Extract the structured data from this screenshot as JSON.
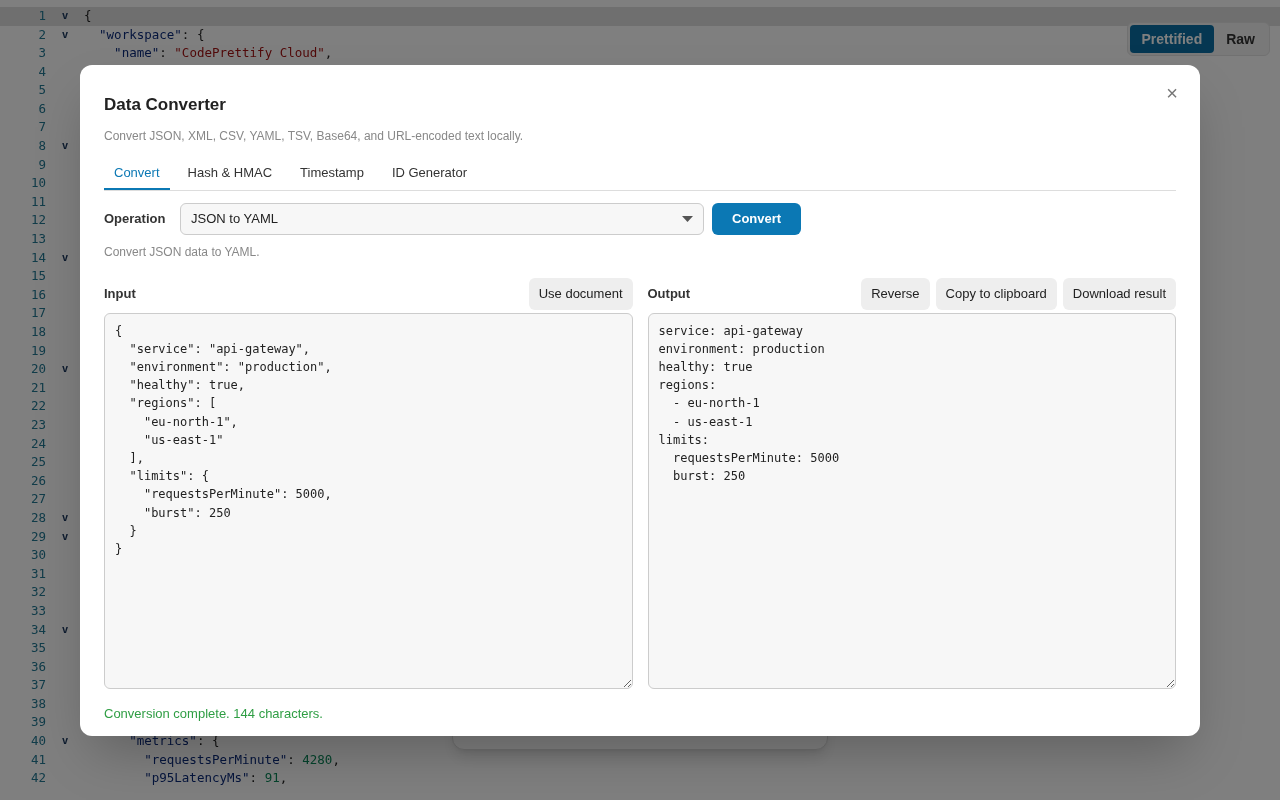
{
  "editor": {
    "lines": [
      {
        "number": "1",
        "fold": "v",
        "current": true,
        "tokens": [
          {
            "kind": "punct",
            "text": "{"
          }
        ]
      },
      {
        "number": "2",
        "fold": "v",
        "current": false,
        "tokens": [
          {
            "kind": "key",
            "text": "  \"workspace\""
          },
          {
            "kind": "punct",
            "text": ": {"
          }
        ]
      },
      {
        "number": "3",
        "current": false,
        "tokens": [
          {
            "kind": "key",
            "text": "    \"name\""
          },
          {
            "kind": "punct",
            "text": ": "
          },
          {
            "kind": "string",
            "text": "\"CodePrettify Cloud\""
          },
          {
            "kind": "punct",
            "text": ","
          }
        ]
      },
      {
        "number": "4",
        "current": false
      },
      {
        "number": "5",
        "current": false
      },
      {
        "number": "6",
        "current": false
      },
      {
        "number": "7",
        "current": false
      },
      {
        "number": "8",
        "fold": "v",
        "current": false
      },
      {
        "number": "9",
        "current": false
      },
      {
        "number": "10",
        "current": false
      },
      {
        "number": "11",
        "current": false
      },
      {
        "number": "12",
        "current": false
      },
      {
        "number": "13",
        "current": false
      },
      {
        "number": "14",
        "fold": "v",
        "current": false
      },
      {
        "number": "15",
        "current": false
      },
      {
        "number": "16",
        "current": false
      },
      {
        "number": "17",
        "current": false
      },
      {
        "number": "18",
        "current": false
      },
      {
        "number": "19",
        "current": false
      },
      {
        "number": "20",
        "fold": "v",
        "current": false
      },
      {
        "number": "21",
        "current": false
      },
      {
        "number": "22",
        "current": false
      },
      {
        "number": "23",
        "current": false
      },
      {
        "number": "24",
        "current": false
      },
      {
        "number": "25",
        "current": false
      },
      {
        "number": "26",
        "current": false
      },
      {
        "number": "27",
        "current": false
      },
      {
        "number": "28",
        "fold": "v",
        "current": false
      },
      {
        "number": "29",
        "fold": "v",
        "current": false
      },
      {
        "number": "30",
        "current": false
      },
      {
        "number": "31",
        "current": false
      },
      {
        "number": "32",
        "current": false
      },
      {
        "number": "33",
        "current": false
      },
      {
        "number": "34",
        "fold": "v",
        "current": false
      },
      {
        "number": "35",
        "current": false
      },
      {
        "number": "36",
        "current": false
      },
      {
        "number": "37",
        "current": false
      },
      {
        "number": "38",
        "current": false
      },
      {
        "number": "39",
        "current": false
      },
      {
        "number": "40",
        "fold": "v",
        "current": false,
        "tokens": [
          {
            "kind": "key",
            "text": "      \"metrics\""
          },
          {
            "kind": "punct",
            "text": ": {"
          }
        ]
      },
      {
        "number": "41",
        "current": false,
        "tokens": [
          {
            "kind": "key",
            "text": "        \"requestsPerMinute\""
          },
          {
            "kind": "punct",
            "text": ": "
          },
          {
            "kind": "number",
            "text": "4280"
          },
          {
            "kind": "punct",
            "text": ","
          }
        ]
      },
      {
        "number": "42",
        "current": false,
        "tokens": [
          {
            "kind": "key",
            "text": "        \"p95LatencyMs\""
          },
          {
            "kind": "punct",
            "text": ": "
          },
          {
            "kind": "number",
            "text": "91"
          },
          {
            "kind": "punct",
            "text": ","
          }
        ]
      }
    ]
  },
  "view_toggle": [
    {
      "label": "Prettified",
      "selected": true
    },
    {
      "label": "Raw",
      "selected": false
    }
  ],
  "dialog": {
    "title": "Data Converter",
    "close": "×",
    "subtitle": "Convert JSON, XML, CSV, YAML, TSV, Base64, and URL-encoded text locally.",
    "tabs": [
      {
        "label": "Convert",
        "selected": true
      },
      {
        "label": "Hash & HMAC",
        "selected": false
      },
      {
        "label": "Timestamp",
        "selected": false
      },
      {
        "label": "ID Generator",
        "selected": false
      }
    ],
    "operation": {
      "label": "Operation",
      "value": "JSON to YAML",
      "button": "Convert",
      "hint": "Convert JSON data to YAML."
    },
    "input": {
      "label": "Input",
      "buttons": [
        "Use document"
      ],
      "text": "{\n  \"service\": \"api-gateway\",\n  \"environment\": \"production\",\n  \"healthy\": true,\n  \"regions\": [\n    \"eu-north-1\",\n    \"us-east-1\"\n  ],\n  \"limits\": {\n    \"requestsPerMinute\": 5000,\n    \"burst\": 250\n  }\n}"
    },
    "output": {
      "label": "Output",
      "buttons": [
        "Reverse",
        "Copy to clipboard",
        "Download result"
      ],
      "text": "service: api-gateway\nenvironment: production\nhealthy: true\nregions:\n  - eu-north-1\n  - us-east-1\nlimits:\n  requestsPerMinute: 5000\n  burst: 250"
    },
    "status": "Conversion complete. 144 characters."
  }
}
